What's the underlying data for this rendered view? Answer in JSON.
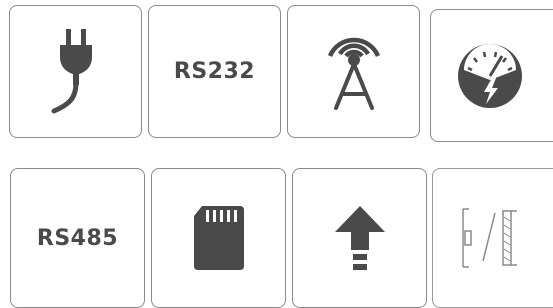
{
  "tiles": [
    {
      "label": "",
      "icon": "power-plug-icon"
    },
    {
      "label": "RS232",
      "icon": ""
    },
    {
      "label": "",
      "icon": "antenna-tower-icon"
    },
    {
      "label": "",
      "icon": "gauge-lightning-icon"
    },
    {
      "label": "RS485",
      "icon": ""
    },
    {
      "label": "",
      "icon": "sd-card-icon"
    },
    {
      "label": "",
      "icon": "upload-arrow-icon"
    },
    {
      "label": "",
      "icon": "wall-mount-icon"
    }
  ],
  "colors": {
    "icon": "#4a4a4a",
    "border": "#8a8a8a",
    "background": "#ffffff"
  }
}
